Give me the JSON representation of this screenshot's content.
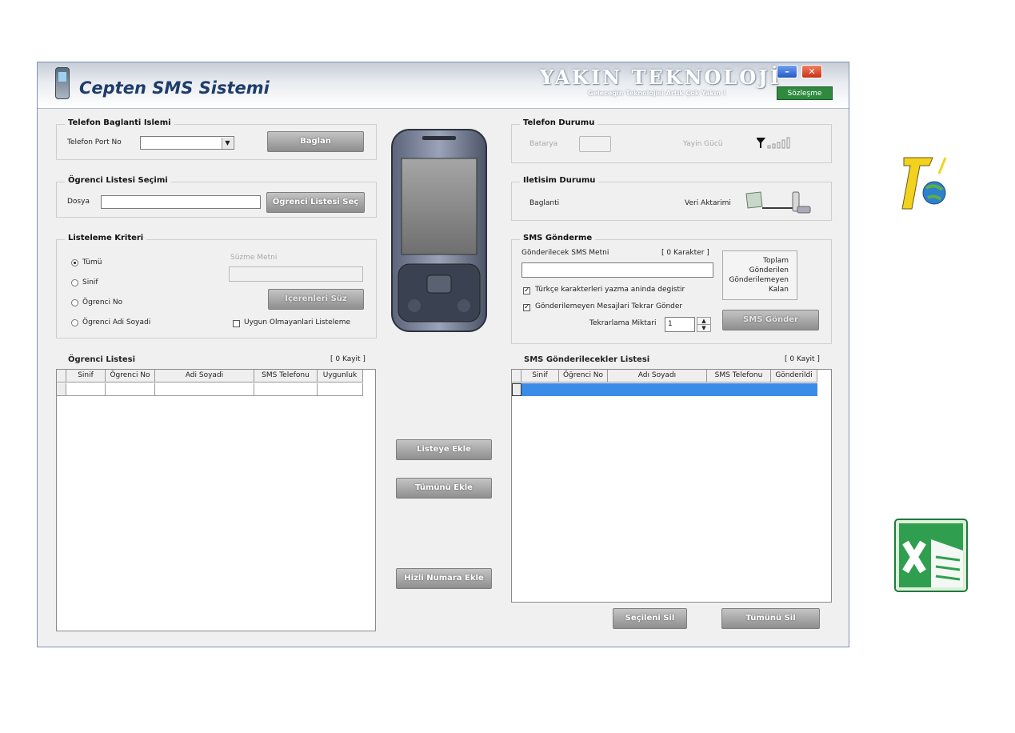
{
  "window": {
    "title": "Cepten SMS Sistemi",
    "brand": "YAKIN TEKNOLOJİ",
    "slogan": "Geleceğin Teknolojisi Artık Çok Yakın !",
    "minimize": "–",
    "close": "✕",
    "agreement_button": "Sözleşme"
  },
  "connection": {
    "group_title": "Telefon Baglanti Islemi",
    "port_label": "Telefon Port No",
    "port_value": "",
    "connect_button": "Baglan"
  },
  "student_select": {
    "group_title": "Ögrenci Listesi Seçimi",
    "file_label": "Dosya",
    "file_value": "",
    "select_button": "Ögrenci Listesi Seç"
  },
  "criteria": {
    "group_title": "Listeleme Kriteri",
    "options": [
      "Tümü",
      "Sinif",
      "Ögrenci No",
      "Ögrenci Adi Soyadi"
    ],
    "selected": "Tümü",
    "filter_label": "Süzme Metni",
    "filter_value": "",
    "filter_button": "Içerenleri Süz",
    "unsuitable_checkbox": "Uygun Olmayanlari Listeleme"
  },
  "phone_status": {
    "group_title": "Telefon Durumu",
    "battery_label": "Batarya",
    "signal_label": "Yayin Gücü"
  },
  "comm_status": {
    "group_title": "Iletisim Durumu",
    "connection_label": "Baglanti",
    "transfer_label": "Veri Aktarimi"
  },
  "sms_send": {
    "group_title": "SMS Gönderme",
    "text_label": "Gönderilecek SMS Metni",
    "char_count": "[ 0 Karakter ]",
    "text_value": "",
    "turkish_checkbox": "Türkçe karakterleri yazma aninda degistir",
    "retry_checkbox": "Gönderilemeyen Mesajlari Tekrar Gönder",
    "retry_label": "Tekrarlama Miktari",
    "retry_value": "1",
    "send_button": "SMS Gönder",
    "stats": [
      "Toplam",
      "Gönderilen",
      "Gönderilemeyen",
      "Kalan"
    ]
  },
  "student_list": {
    "title": "Ögrenci Listesi",
    "count": "[ 0 Kayit ]",
    "columns": [
      "Sinif",
      "Ögrenci No",
      "Adi Soyadi",
      "SMS Telefonu",
      "Uygunluk"
    ]
  },
  "middle_buttons": {
    "add_to_list": "Listeye Ekle",
    "add_all": "Tümünü Ekle",
    "quick_number": "Hizli Numara Ekle"
  },
  "sms_list": {
    "title": "SMS Gönderilecekler Listesi",
    "count": "[ 0 Kayit ]",
    "columns": [
      "Sinif",
      "Öğrenci No",
      "Adı Soyadı",
      "SMS Telefonu",
      "Gönderildi"
    ],
    "delete_selected": "Seçileni Sil",
    "delete_all": "Tümünü Sil"
  },
  "colors": {
    "accent": "#1f3d6a",
    "selection": "#3b8be8",
    "agreement": "#2f8a3e"
  }
}
